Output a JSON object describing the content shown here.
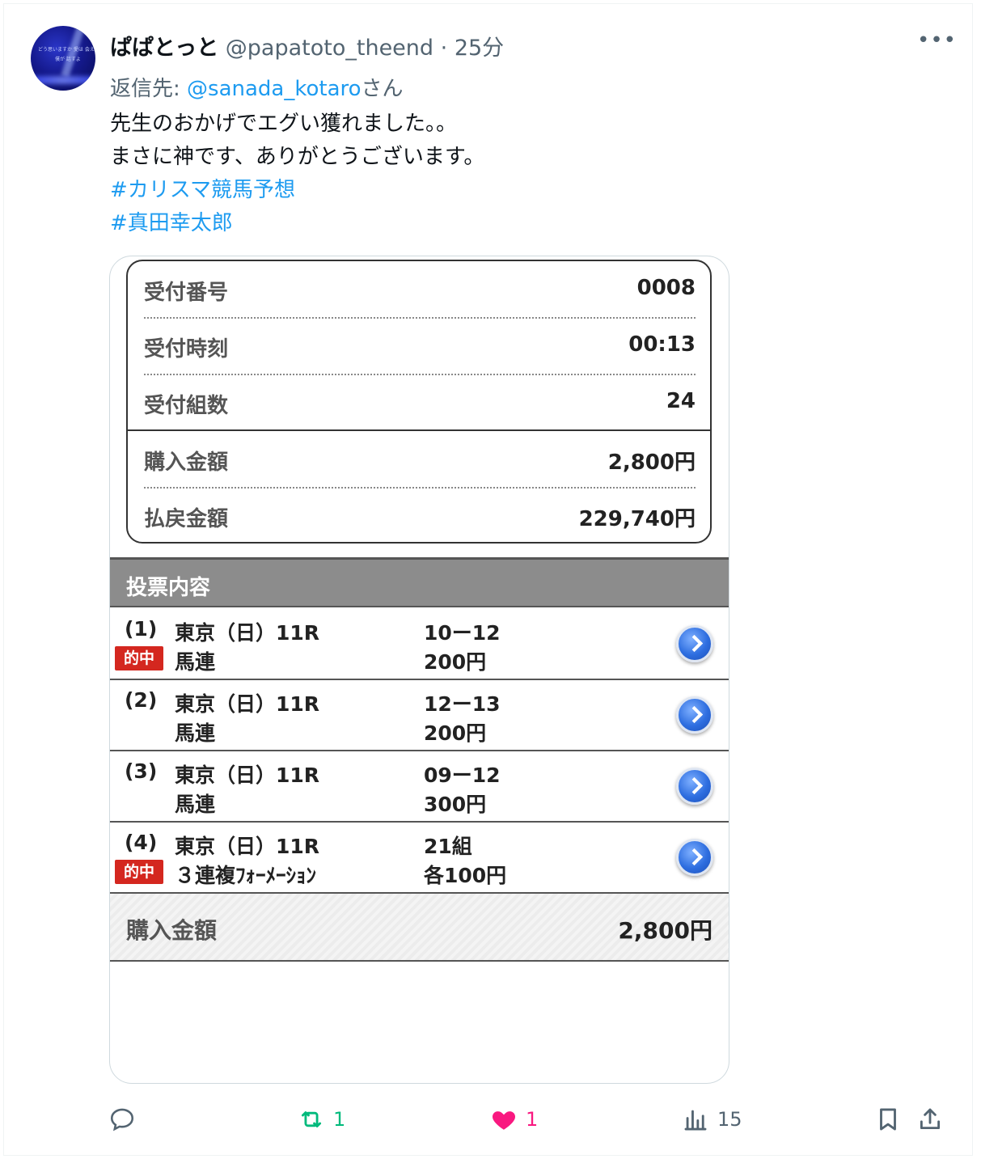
{
  "tweet": {
    "display_name": "ぱぱとっと",
    "handle": "@papatoto_theend",
    "separator": " · ",
    "time": "25分",
    "more_label": "•••",
    "reply_prefix": "返信先: ",
    "reply_to": "@sanada_kotaro",
    "reply_suffix": "さん",
    "text_line1": "先生のおかげでエグい獲れました。。",
    "text_line2": "まさに神です、ありがとうございます。",
    "hashtags": [
      "#カリスマ競馬予想",
      "#真田幸太郎"
    ],
    "avatar_text1": "どう思いますか 愛は 会えないけど",
    "avatar_text2": "僕が 話すよ"
  },
  "ticket": {
    "rows": [
      {
        "label": "受付番号",
        "value": "0008"
      },
      {
        "label": "受付時刻",
        "value": "00:13"
      },
      {
        "label": "受付組数",
        "value": "24"
      },
      {
        "label": "購入金額",
        "value": "2,800円"
      },
      {
        "label": "払戻金額",
        "value": "229,740円"
      }
    ],
    "section_title": "投票内容",
    "bets": [
      {
        "num": "(1)",
        "venue": "東京（日）11R",
        "type": "馬連",
        "combo": "10ー12",
        "amount": "200円",
        "hit": "的中"
      },
      {
        "num": "(2)",
        "venue": "東京（日）11R",
        "type": "馬連",
        "combo": "12ー13",
        "amount": "200円",
        "hit": ""
      },
      {
        "num": "(3)",
        "venue": "東京（日）11R",
        "type": "馬連",
        "combo": "09ー12",
        "amount": "300円",
        "hit": ""
      },
      {
        "num": "(4)",
        "venue": "東京（日）11R",
        "type": "３連複ﾌｫｰﾒｰｼｮﾝ",
        "combo": "21組",
        "amount": "各100円",
        "hit": "的中"
      }
    ],
    "total_label": "購入金額",
    "total_value": "2,800円"
  },
  "actions": {
    "reply_count": "",
    "retweet_count": "1",
    "like_count": "1",
    "views_count": "15"
  },
  "colors": {
    "link": "#1d9bf0",
    "retweet": "#00ba7c",
    "like": "#f91880",
    "hit_badge": "#d4271f"
  }
}
